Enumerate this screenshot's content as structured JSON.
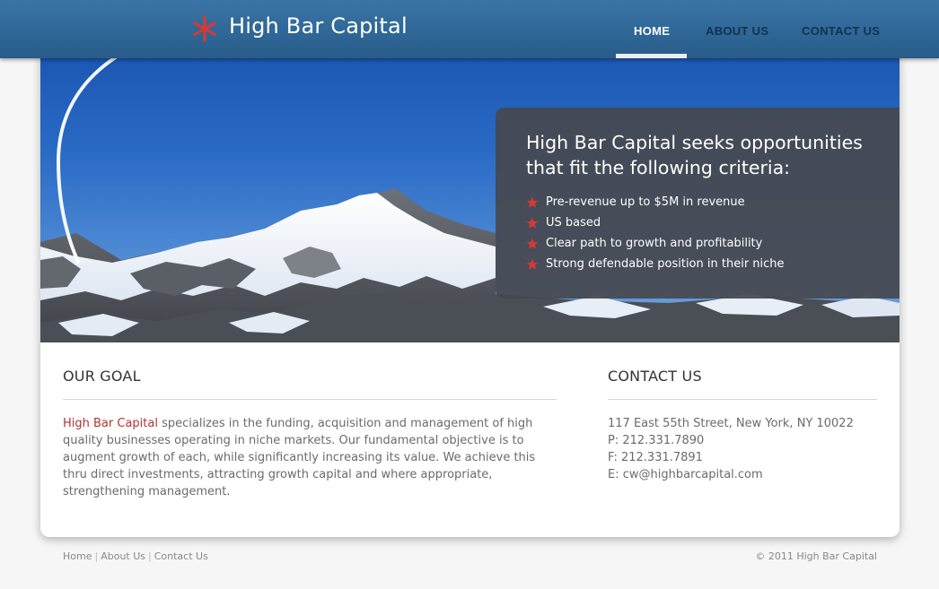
{
  "header": {
    "logo_text": "High Bar Capital",
    "logo_icon": "red-asterisk-star-icon",
    "nav": [
      {
        "label": "HOME",
        "active": true
      },
      {
        "label": "ABOUT US",
        "active": false
      },
      {
        "label": "CONTACT US",
        "active": false
      }
    ]
  },
  "hero": {
    "title": "High Bar Capital seeks opportunities that fit the following criteria:",
    "criteria": [
      "Pre-revenue up to $5M in revenue",
      "US based",
      "Clear path to growth and profitability",
      "Strong defendable position in their niche"
    ],
    "bullet_icon": "red-star-icon"
  },
  "goal": {
    "heading": "OUR GOAL",
    "brand": "High Bar Capital",
    "text": " specializes in the funding, acquisition and management of high quality businesses operating in niche markets. Our fundamental objective is to augment growth of each, while significantly increasing its value. We achieve this thru direct investments, attracting growth capital and where appropriate, strengthening management."
  },
  "contact": {
    "heading": "CONTACT US",
    "address": "117 East 55th Street, New York, NY 10022",
    "phone": "P: 212.331.7890",
    "fax": "F: 212.331.7891",
    "email": "E: cw@highbarcapital.com"
  },
  "footer": {
    "links": [
      "Home",
      "About Us",
      "Contact Us"
    ],
    "copyright": "© 2011 High Bar Capital"
  },
  "colors": {
    "header_blue": "#2f6797",
    "accent_red": "#d63a33",
    "nav_text": "#13304d"
  }
}
